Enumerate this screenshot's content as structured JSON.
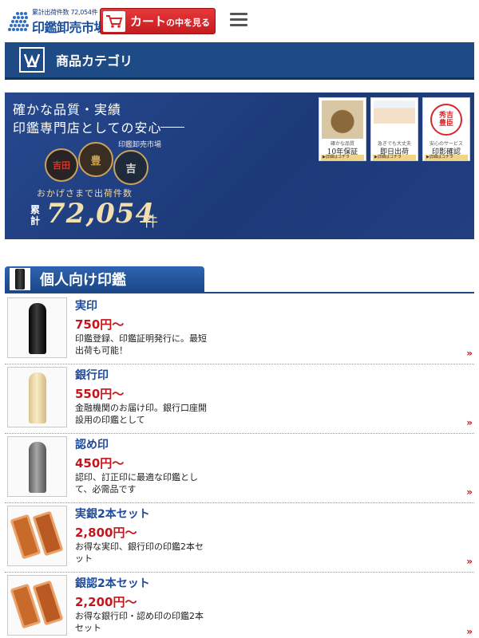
{
  "header": {
    "logo_small": "累計出荷件数 72,054件",
    "logo_main": "印鑑卸売市場",
    "cart_button": {
      "big": "カート",
      "small": "の中を見る"
    }
  },
  "category_bar": {
    "title": "商品カテゴリ"
  },
  "banner": {
    "line1": "確かな品質・実績",
    "line2": "印鑑専門店としての安心",
    "shop_name": "印鑑卸売市場",
    "shipped_label": "おかげさまで出荷件数",
    "cumulative": "累計",
    "count": "72,054",
    "unit": "件",
    "note": "※",
    "seals": [
      "吉田",
      "豊",
      "吉"
    ],
    "features": [
      {
        "caption": "確かな品質",
        "title": "10年保証",
        "more": "▶詳細はコチラ"
      },
      {
        "caption": "急ぎでも大丈夫",
        "title": "即日出荷",
        "more": "▶詳細はコチラ"
      },
      {
        "caption": "安心のサービス",
        "title": "印影確認",
        "more": "▶詳細はコチラ"
      }
    ],
    "sample_seal": "秀吉豊臣"
  },
  "section": {
    "title": "個人向け印鑑"
  },
  "products": [
    {
      "name": "実印",
      "price": "750円〜",
      "desc": "印鑑登録、印鑑証明発行に。最短出荷も可能！",
      "thumb": "black-seal"
    },
    {
      "name": "銀行印",
      "price": "550円〜",
      "desc": "金融機関のお届け印。銀行口座開設用の印鑑として",
      "thumb": "ivory-seal"
    },
    {
      "name": "認め印",
      "price": "450円〜",
      "desc": "認印、訂正印に最適な印鑑として、必需品です",
      "thumb": "gray-seal"
    },
    {
      "name": "実銀2本セット",
      "price": "2,800円〜",
      "desc": "お得な実印、銀行印の印鑑2本セット",
      "thumb": "case-set"
    },
    {
      "name": "銀認2本セット",
      "price": "2,200円〜",
      "desc": "お得な銀行印・認め印の印鑑2本セット",
      "thumb": "case-set"
    }
  ],
  "chevron": "»",
  "colors": {
    "brand_blue": "#1e4a86",
    "price_red": "#c3161c",
    "cart_red": "#d8272b"
  }
}
